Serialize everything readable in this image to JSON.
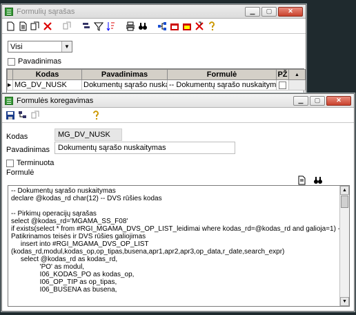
{
  "list_window": {
    "title": "Formulių sąrašas",
    "filter_value": "Visi",
    "checkbox_label": "Pavadinimas",
    "grid": {
      "columns": [
        "Kodas",
        "Pavadinimas",
        "Formulė",
        "PŽ"
      ],
      "rows": [
        {
          "kodas": "MG_DV_NUSK",
          "pavadinimas": "Dokumentų sąrašo nuskaitymas",
          "formule": "-- Dokumentų sąrašo nuskaitymas"
        }
      ]
    }
  },
  "edit_window": {
    "title": "Formulės koregavimas",
    "kodas_label": "Kodas",
    "kodas_value": "MG_DV_NUSK",
    "pavadinimas_label": "Pavadinimas",
    "pavadinimas_value": "Dokumentų sąrašo nuskaitymas",
    "terminuota_label": "Terminuota",
    "formule_label": "Formulė",
    "code": "-- Dokumentų sąrašo nuskaitymas\ndeclare @kodas_rd char(12) -- DVS rūšies kodas\n\n-- Pirkimų operacijų sąrašas\nselect @kodas_rd='MGAMA_SS_F08'\nif exists(select * from #RGI_MGAMA_DVS_OP_LIST_leidimai where kodas_rd=@kodas_rd and galioja=1) --\nPatikrinamos teisės ir DVS rūšies galiojimas\n     insert into #RGI_MGAMA_DVS_OP_LIST\n(kodas_rd,modul,kodas_op,op_tipas,busena,apr1,apr2,apr3,op_data,r_date,search_expr)\n     select @kodas_rd as kodas_rd,\n               'PO' as modul,\n               I06_KODAS_PO as kodas_op,\n               I06_OP_TIP as op_tipas,\n               I06_BUSENA as busena,"
  },
  "colors": {
    "window_bg": "#d4d0c8",
    "desktop": "#1f2a2e",
    "close_button": "#c9422c"
  }
}
